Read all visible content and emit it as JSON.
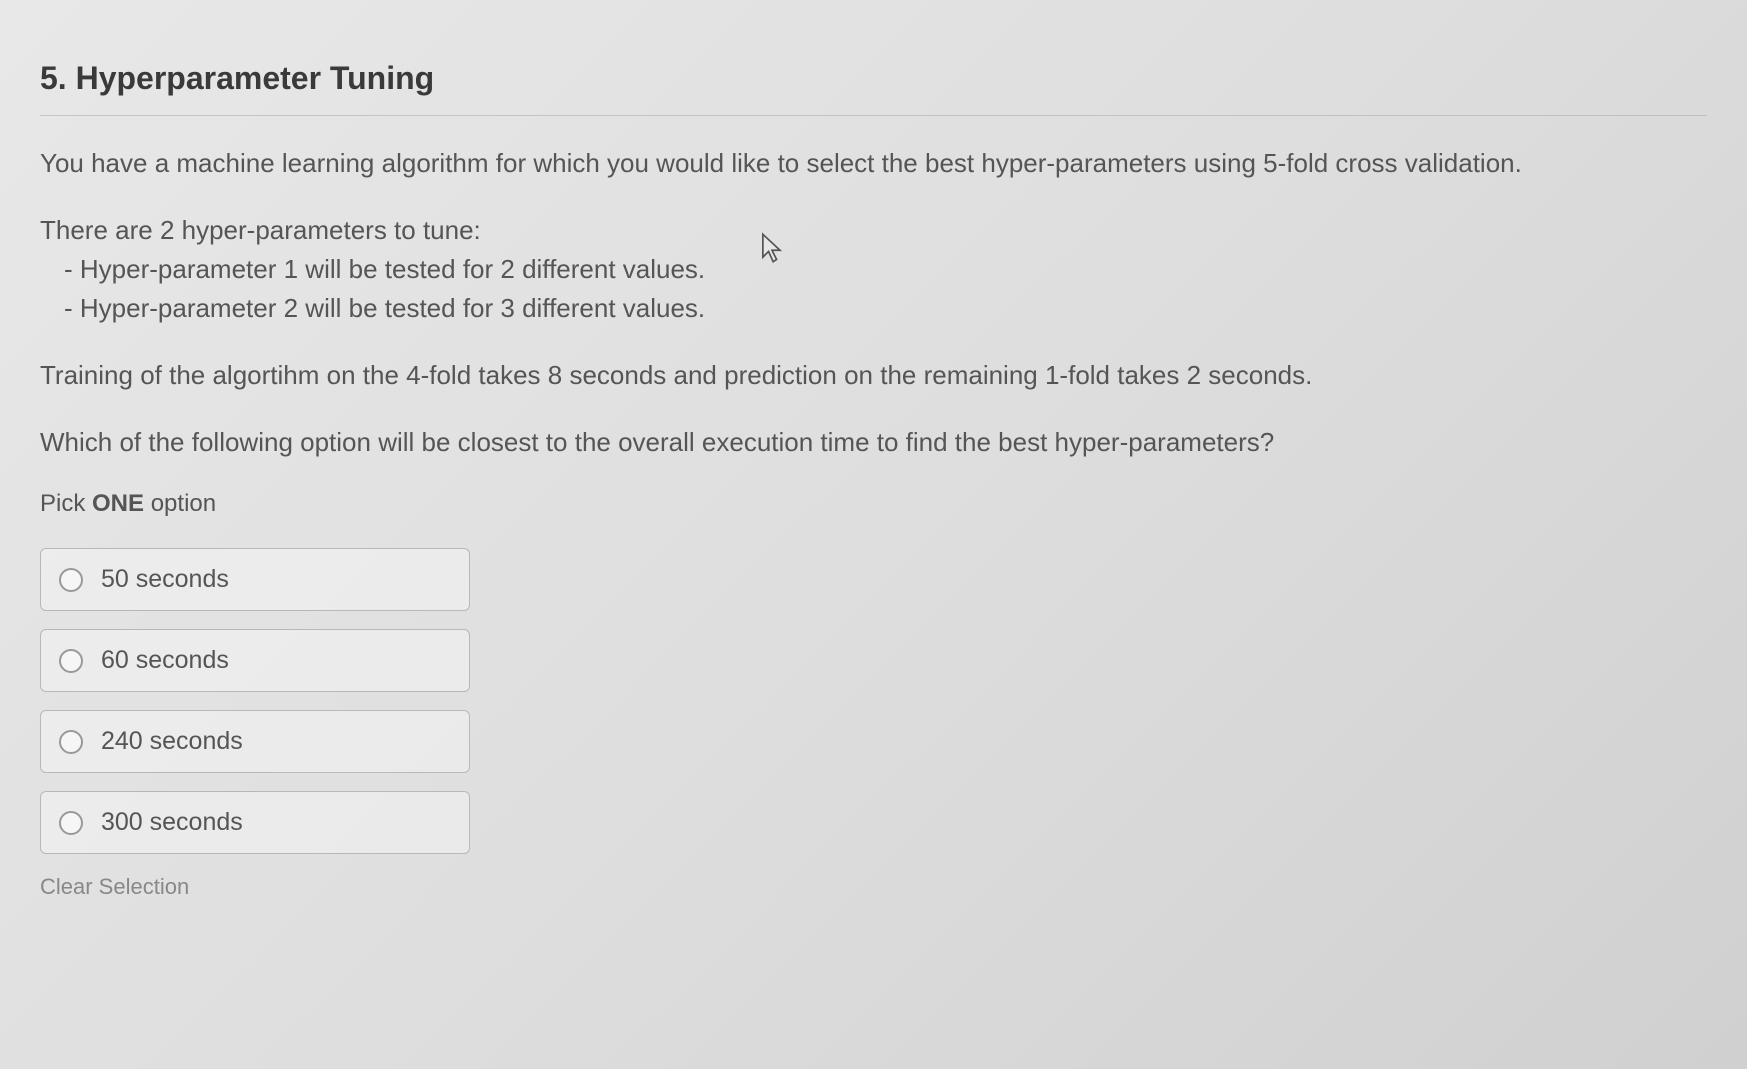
{
  "question": {
    "number": "5.",
    "title": "Hyperparameter Tuning",
    "intro": "You have a machine learning algorithm for which you would like to select the best hyper-parameters using 5-fold cross validation.",
    "params_intro": "There are 2 hyper-parameters to tune:",
    "bullets": [
      "- Hyper-parameter 1 will be tested for 2 different values.",
      "- Hyper-parameter 2 will be tested for 3 different values."
    ],
    "timing": "Training of the algortihm on the 4-fold takes 8 seconds and prediction on the remaining 1-fold takes 2 seconds.",
    "prompt": "Which of the following option will be closest to the overall execution time to find the best hyper-parameters?",
    "pick_prefix": "Pick ",
    "pick_bold": "ONE",
    "pick_suffix": " option"
  },
  "options": [
    {
      "label": "50 seconds"
    },
    {
      "label": "60 seconds"
    },
    {
      "label": "240 seconds"
    },
    {
      "label": "300 seconds"
    }
  ],
  "actions": {
    "clear_selection": "Clear Selection"
  }
}
